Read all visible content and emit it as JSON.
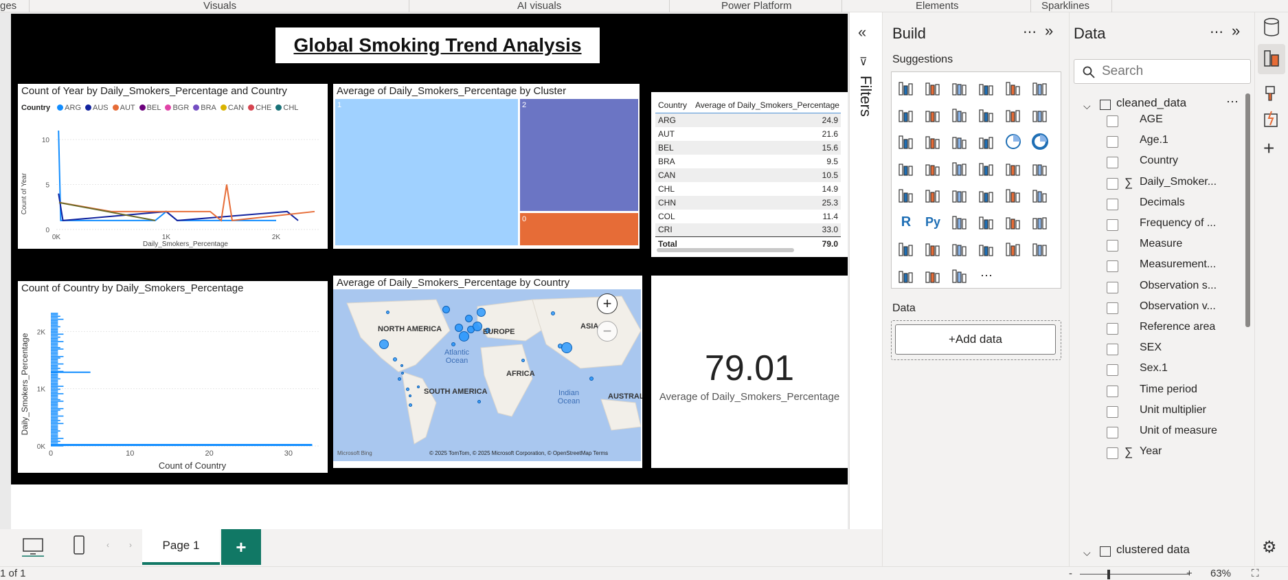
{
  "ribbon": {
    "tabs": [
      "ges",
      "Visuals",
      "AI visuals",
      "Power Platform",
      "Elements",
      "Sparklines"
    ]
  },
  "report": {
    "title": "Global Smoking Trend Analysis",
    "line_chart": {
      "title": "Count of Year by Daily_Smokers_Percentage and Country",
      "legend_title": "Country",
      "legend": [
        {
          "name": "ARG",
          "color": "#118dff"
        },
        {
          "name": "AUS",
          "color": "#12239e"
        },
        {
          "name": "AUT",
          "color": "#e66c37"
        },
        {
          "name": "BEL",
          "color": "#6b007b"
        },
        {
          "name": "BGR",
          "color": "#e044a7"
        },
        {
          "name": "BRA",
          "color": "#744ec2"
        },
        {
          "name": "CAN",
          "color": "#d9b300"
        },
        {
          "name": "CHE",
          "color": "#d64550"
        },
        {
          "name": "CHL",
          "color": "#197278"
        }
      ],
      "xlabel": "Daily_Smokers_Percentage",
      "ylabel": "Count of Year",
      "xticks": [
        "0K",
        "1K",
        "2K"
      ],
      "yticks": [
        "0",
        "5",
        "10"
      ]
    },
    "treemap": {
      "title": "Average of Daily_Smokers_Percentage by Cluster",
      "cells": [
        {
          "label": "1",
          "color": "#a0d1ff"
        },
        {
          "label": "2",
          "color": "#6b75c4"
        },
        {
          "label": "0",
          "color": "#e66c37"
        }
      ]
    },
    "table": {
      "columns": [
        "Country",
        "Average of Daily_Smokers_Percentage"
      ],
      "rows": [
        [
          "ARG",
          "24.9"
        ],
        [
          "AUT",
          "21.6"
        ],
        [
          "BEL",
          "15.6"
        ],
        [
          "BRA",
          "9.5"
        ],
        [
          "CAN",
          "10.5"
        ],
        [
          "CHL",
          "14.9"
        ],
        [
          "CHN",
          "25.3"
        ],
        [
          "COL",
          "11.4"
        ],
        [
          "CRI",
          "33.0"
        ]
      ],
      "total_label": "Total",
      "total_value": "79.0"
    },
    "bar_chart": {
      "title": "Count of Country by Daily_Smokers_Percentage",
      "xlabel": "Count of Country",
      "ylabel": "Daily_Smokers_Percentage",
      "xticks": [
        "0",
        "10",
        "20",
        "30"
      ],
      "yticks": [
        "0K",
        "1K",
        "2K"
      ]
    },
    "map": {
      "title": "Average of Daily_Smokers_Percentage by Country",
      "labels": [
        "NORTH AMERICA",
        "EUROPE",
        "ASIA",
        "AFRICA",
        "SOUTH AMERICA",
        "AUSTRAL",
        "Atlantic Ocean",
        "Indian Ocean"
      ],
      "attribution": "© 2025 TomTom, © 2025 Microsoft Corporation, © OpenStreetMap  Terms",
      "brand": "Microsoft Bing"
    },
    "card": {
      "value": "79.01",
      "label": "Average of Daily_Smokers_Percentage"
    }
  },
  "chart_data": [
    {
      "type": "line",
      "title": "Count of Year by Daily_Smokers_Percentage and Country",
      "xlabel": "Daily_Smokers_Percentage",
      "ylabel": "Count of Year",
      "xlim": [
        0,
        2400
      ],
      "ylim": [
        0,
        11
      ],
      "series": [
        {
          "name": "ARG",
          "values": [
            [
              20,
              11
            ],
            [
              40,
              1
            ],
            [
              900,
              1
            ],
            [
              1000,
              2
            ],
            [
              1100,
              1
            ],
            [
              2000,
              1
            ]
          ]
        },
        {
          "name": "AUS",
          "values": [
            [
              20,
              4
            ],
            [
              60,
              1
            ],
            [
              1000,
              2
            ],
            [
              1100,
              1
            ],
            [
              2100,
              2
            ],
            [
              2200,
              1
            ]
          ]
        },
        {
          "name": "AUT",
          "values": [
            [
              30,
              3
            ],
            [
              500,
              2
            ],
            [
              1400,
              2
            ],
            [
              1500,
              1
            ],
            [
              1550,
              5
            ],
            [
              1600,
              1
            ],
            [
              2350,
              2
            ]
          ]
        }
      ]
    },
    {
      "type": "bar",
      "title": "Count of Country by Daily_Smokers_Percentage",
      "xlabel": "Count of Country",
      "ylabel": "Daily_Smokers_Percentage",
      "xlim": [
        0,
        34
      ],
      "ylim": [
        0,
        2400
      ]
    },
    {
      "type": "table",
      "title": "Average of Daily_Smokers_Percentage by Country",
      "categories": [
        "ARG",
        "AUT",
        "BEL",
        "BRA",
        "CAN",
        "CHL",
        "CHN",
        "COL",
        "CRI"
      ],
      "values": [
        24.9,
        21.6,
        15.6,
        9.5,
        10.5,
        14.9,
        25.3,
        11.4,
        33.0
      ]
    }
  ],
  "pages": {
    "tab_label": "Page 1",
    "add_label": "+"
  },
  "status": {
    "page_info": "1 of 1",
    "zoom": "63%"
  },
  "filters": {
    "label": "Filters"
  },
  "build": {
    "title": "Build",
    "suggestions": "Suggestions",
    "data_label": "Data",
    "add_data": "+Add data"
  },
  "data_pane": {
    "title": "Data",
    "search_placeholder": "Search",
    "table1": "cleaned_data",
    "fields": [
      {
        "name": "AGE",
        "sigma": false
      },
      {
        "name": "Age.1",
        "sigma": false
      },
      {
        "name": "Country",
        "sigma": false
      },
      {
        "name": "Daily_Smoker...",
        "sigma": true
      },
      {
        "name": "Decimals",
        "sigma": false
      },
      {
        "name": "Frequency of ...",
        "sigma": false
      },
      {
        "name": "Measure",
        "sigma": false
      },
      {
        "name": "Measurement...",
        "sigma": false
      },
      {
        "name": "Observation s...",
        "sigma": false
      },
      {
        "name": "Observation v...",
        "sigma": false
      },
      {
        "name": "Reference area",
        "sigma": false
      },
      {
        "name": "SEX",
        "sigma": false
      },
      {
        "name": "Sex.1",
        "sigma": false
      },
      {
        "name": "Time period",
        "sigma": false
      },
      {
        "name": "Unit multiplier",
        "sigma": false
      },
      {
        "name": "Unit of measure",
        "sigma": false
      },
      {
        "name": "Year",
        "sigma": true
      }
    ],
    "table2": "clustered data"
  }
}
